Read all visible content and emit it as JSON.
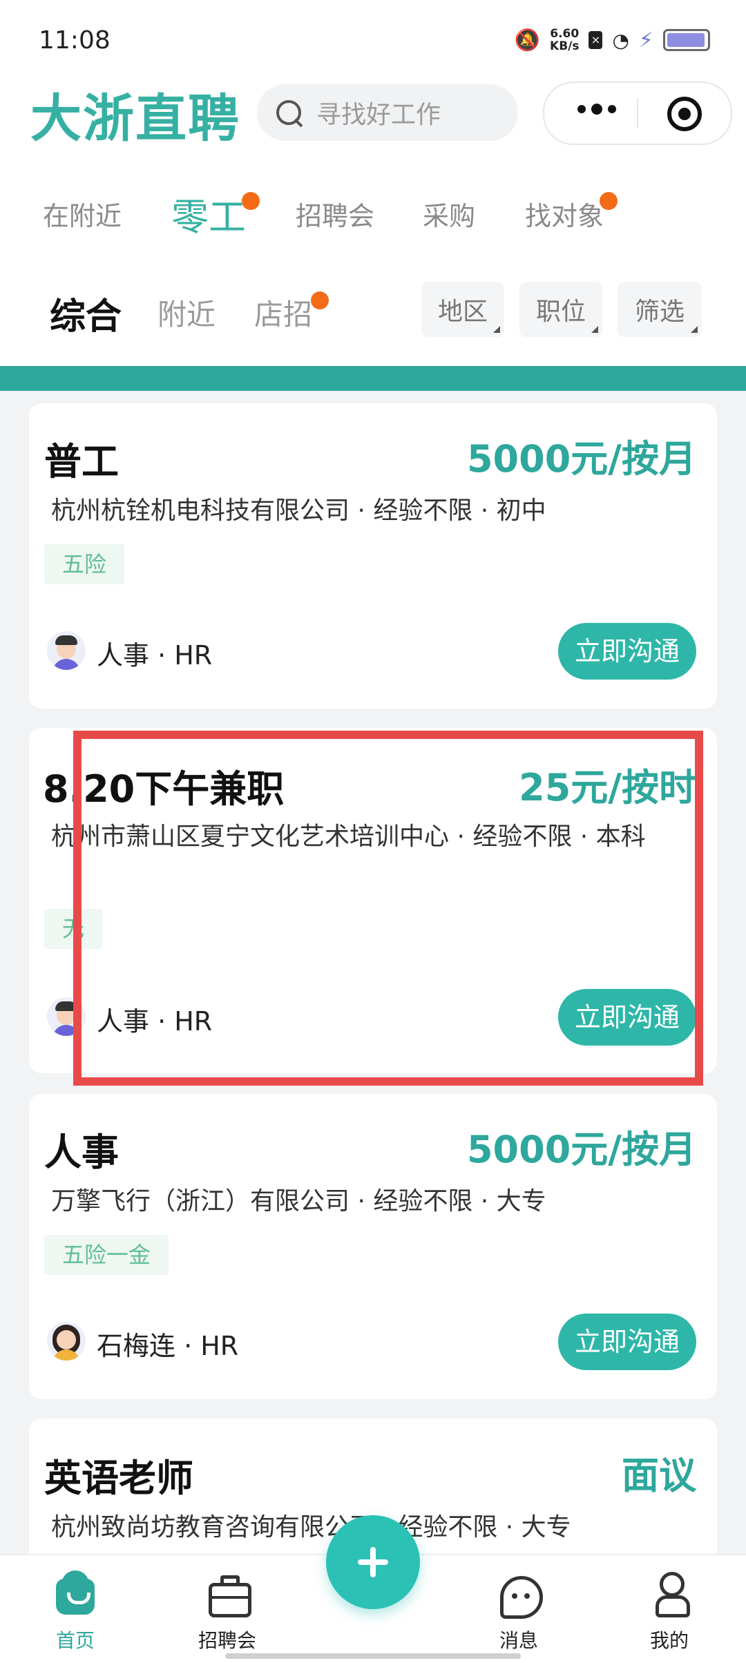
{
  "status_bar": {
    "time": "11:08",
    "net_speed_value": "6.60",
    "net_speed_unit": "KB/s"
  },
  "header": {
    "brand": "大浙直聘",
    "search_placeholder": "寻找好工作"
  },
  "category_tabs": [
    {
      "label": "在附近",
      "active": false,
      "dot": false
    },
    {
      "label": "零工",
      "active": true,
      "dot": true
    },
    {
      "label": "招聘会",
      "active": false,
      "dot": false
    },
    {
      "label": "采购",
      "active": false,
      "dot": false
    },
    {
      "label": "找对象",
      "active": false,
      "dot": true
    }
  ],
  "sub_tabs": [
    {
      "label": "综合",
      "active": true
    },
    {
      "label": "附近",
      "active": false
    },
    {
      "label": "店招",
      "active": false,
      "dot": true
    }
  ],
  "filters": [
    "地区",
    "职位",
    "筛选"
  ],
  "jobs": [
    {
      "title": "普工",
      "salary": "5000元/按月",
      "company_line": "杭州杭铨机电科技有限公司 · 经验不限 · 初中",
      "tag": "五险",
      "recruiter": "人事 · HR",
      "action": "立即沟通"
    },
    {
      "title": "8.20下午兼职",
      "salary": "25元/按时",
      "company_line": "杭州市萧山区夏宁文化艺术培训中心 · 经验不限 · 本科",
      "tag": "无",
      "recruiter": "人事 · HR",
      "action": "立即沟通"
    },
    {
      "title": "人事",
      "salary": "5000元/按月",
      "company_line": "万擎飞行（浙江）有限公司 · 经验不限 · 大专",
      "tag": "五险一金",
      "recruiter": "石梅连 · HR",
      "action": "立即沟通"
    },
    {
      "title": "英语老师",
      "salary": "面议",
      "company_line": "杭州致尚坊教育咨询有限公司 · 经验不限 · 大专"
    }
  ],
  "bottom_nav": [
    {
      "label": "首页",
      "icon": "home-icon",
      "active": true
    },
    {
      "label": "招聘会",
      "icon": "briefcase-icon",
      "active": false
    },
    {
      "label": "消息",
      "icon": "message-icon",
      "active": false
    },
    {
      "label": "我的",
      "icon": "profile-icon",
      "active": false
    }
  ],
  "colors": {
    "brand": "#36b0a3",
    "accent": "#2eb7a8",
    "dot": "#f36b16",
    "highlight": "#e84a4a"
  }
}
